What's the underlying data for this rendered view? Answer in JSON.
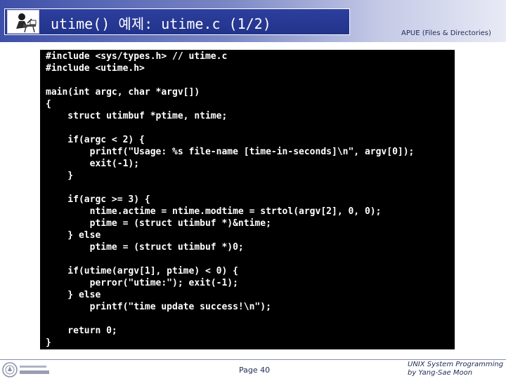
{
  "header": {
    "title": "utime() 예제: utime.c (1/2)",
    "course": "APUE (Files & Directories)",
    "logo_icon": "person-at-desk-icon"
  },
  "code": {
    "lines": [
      "#include <sys/types.h> // utime.c",
      "#include <utime.h>",
      "",
      "main(int argc, char *argv[])",
      "{",
      "    struct utimbuf *ptime, ntime;",
      "",
      "    if(argc < 2) {",
      "        printf(\"Usage: %s file-name [time-in-seconds]\\n\", argv[0]);",
      "        exit(-1);",
      "    }",
      "",
      "    if(argc >= 3) {",
      "        ntime.actime = ntime.modtime = strtol(argv[2], 0, 0);",
      "        ptime = (struct utimbuf *)&ntime;",
      "    } else",
      "        ptime = (struct utimbuf *)0;",
      "",
      "    if(utime(argv[1], ptime) < 0) {",
      "        perror(\"utime:\"); exit(-1);",
      "    } else",
      "        printf(\"time update success!\\n\");",
      "",
      "    return 0;",
      "}"
    ]
  },
  "footer": {
    "page": "Page 40",
    "credit_line1": "UNIX System Programming",
    "credit_line2": "by Yang-Sae Moon",
    "logo_icon": "university-seal-icon"
  },
  "colors": {
    "title_bg": "#2c3f9e",
    "code_bg": "#000000",
    "code_fg": "#ffffff",
    "text_dark": "#1f2a55"
  }
}
